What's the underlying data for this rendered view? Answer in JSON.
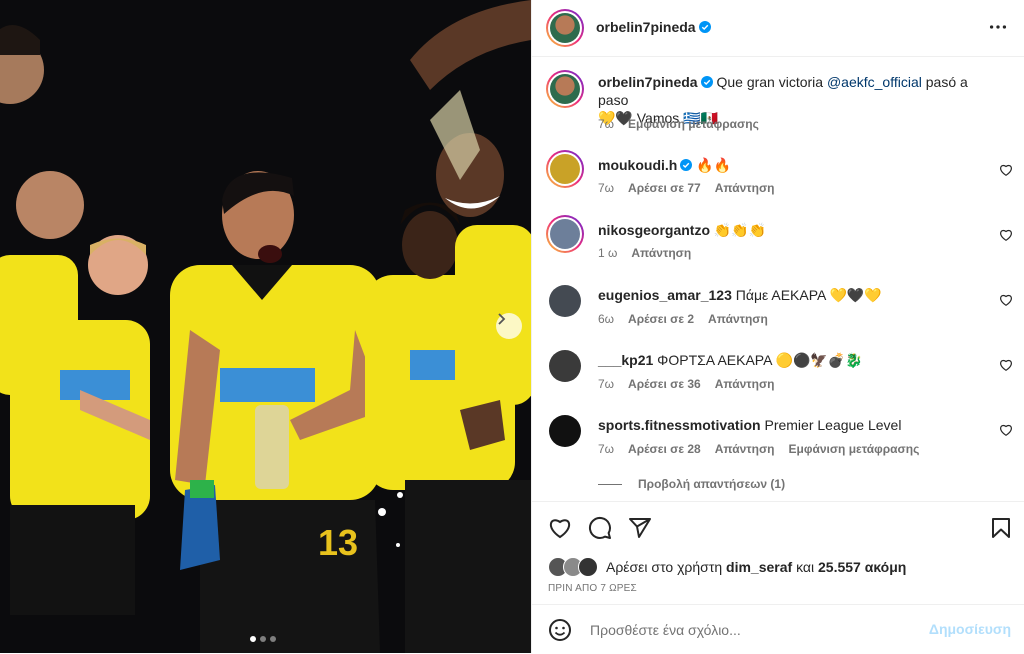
{
  "post": {
    "author": "orbelin7pineda",
    "more_icon": "more-horizontal-icon",
    "photo": {
      "description_icon": "photo",
      "carousel_count": 3,
      "carousel_active": 1
    }
  },
  "caption": {
    "user": "orbelin7pineda",
    "text_before": "Que gran victoria ",
    "mention": "@aekfc_official",
    "text_after": " pasó a paso",
    "line2": "💛🖤 Vamos 🇬🇷🇲🇽",
    "time": "7ω",
    "translate": "Εμφάνιση μετάφρασης"
  },
  "comments": [
    {
      "user": "moukoudi.h",
      "verified": true,
      "text": "🔥🔥",
      "time": "7ω",
      "likes": "Αρέσει σε 77",
      "reply": "Απάντηση",
      "translate": "",
      "avatar_color": "#c9a227"
    },
    {
      "user": "nikosgeorgantzo",
      "verified": false,
      "text": "👏👏👏",
      "time": "1 ω",
      "likes": "",
      "reply": "Απάντηση",
      "translate": "",
      "avatar_color": "#6d7f9a"
    },
    {
      "user": "eugenios_amar_123",
      "verified": false,
      "text": "Πάμε ΑΕΚΑΡΑ 💛🖤💛",
      "time": "6ω",
      "likes": "Αρέσει σε 2",
      "reply": "Απάντηση",
      "translate": "",
      "avatar_color": "#444a52"
    },
    {
      "user": "___kp21",
      "verified": false,
      "text": "ΦΟΡΤΣΑ ΑΕΚΑΡΑ 🟡⚫🦅💣🐉",
      "time": "7ω",
      "likes": "Αρέσει σε 36",
      "reply": "Απάντηση",
      "translate": "",
      "avatar_color": "#3a3a3a"
    },
    {
      "user": "sports.fitnessmotivation",
      "verified": false,
      "text": "Premier League Level",
      "time": "7ω",
      "likes": "Αρέσει σε 28",
      "reply": "Απάντηση",
      "translate": "Εμφάνιση μετάφρασης",
      "avatar_color": "#111111"
    }
  ],
  "view_replies": "Προβολή απαντήσεων (1)",
  "actions": {
    "like_icon": "heart-icon",
    "comment_icon": "comment-icon",
    "share_icon": "share-icon",
    "save_icon": "bookmark-icon"
  },
  "likes": {
    "prefix": "Αρέσει στο χρήστη ",
    "user": "dim_seraf",
    "middle": " και ",
    "count": "25.557 ακόμη"
  },
  "timestamp": "ΠΡΙΝ ΑΠΟ 7 ΩΡΕΣ",
  "comment_box": {
    "placeholder": "Προσθέστε ένα σχόλιο...",
    "post_label": "Δημοσίευση"
  },
  "colors": {
    "verified": "#0095f6",
    "aek_yellow": "#f2e21a",
    "link": "#00376b",
    "post_disabled": "#b2dffc"
  }
}
